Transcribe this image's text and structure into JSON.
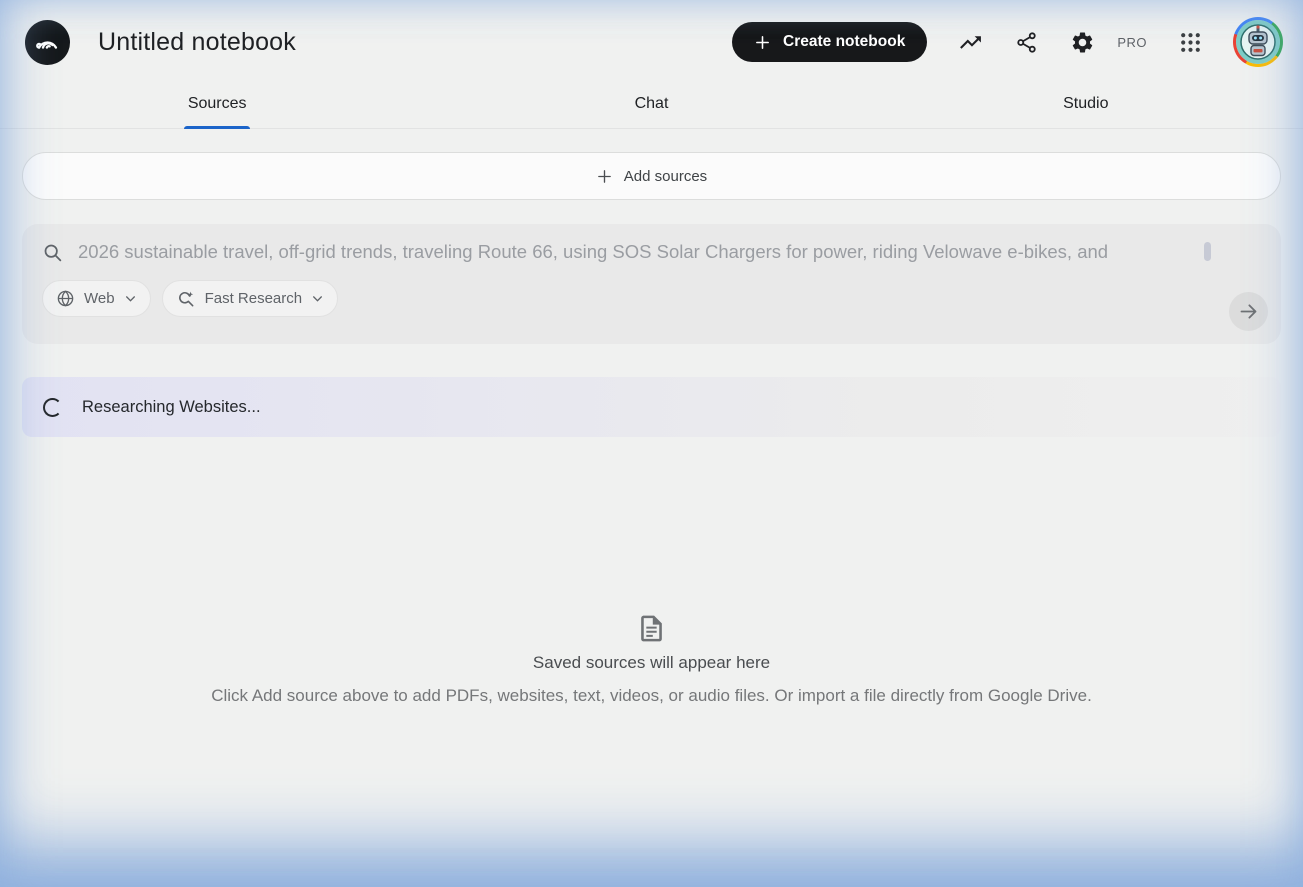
{
  "header": {
    "title": "Untitled notebook",
    "create_button_label": "Create notebook",
    "pro_label": "PRO"
  },
  "tabs": [
    {
      "label": "Sources",
      "active": true
    },
    {
      "label": "Chat",
      "active": false
    },
    {
      "label": "Studio",
      "active": false
    }
  ],
  "sources": {
    "add_sources_label": "Add sources",
    "research_input": {
      "placeholder": "2026 sustainable travel, off-grid trends, traveling Route 66, using SOS Solar Chargers for power, riding Velowave e-bikes, and",
      "source_selector_value": "Web",
      "mode_selector_value": "Fast Research"
    },
    "status_message": "Researching Websites...",
    "empty_state": {
      "title": "Saved sources will appear here",
      "description": "Click Add source above to add PDFs, websites, text, videos, or audio files. Or import a file directly from Google Drive."
    }
  },
  "icons": {
    "app_logo": "notebooklm-logo",
    "header": [
      "plus-icon",
      "trending-up-icon",
      "share-icon",
      "gear-icon",
      "apps-grid-icon",
      "avatar"
    ],
    "research": [
      "search-icon",
      "globe-icon",
      "research-sparkle-icon",
      "chevron-down-icon",
      "arrow-right-icon",
      "spinner"
    ],
    "empty": [
      "document-icon"
    ]
  },
  "colors": {
    "accent_blue": "#1b64c9",
    "primary_button_bg": "#17181a",
    "search_panel_bg": "#e9e9e9",
    "status_gradient_start": "#e2e2f3",
    "status_gradient_end": "#efefef",
    "edge_glow_blue": "#7aa3da"
  }
}
